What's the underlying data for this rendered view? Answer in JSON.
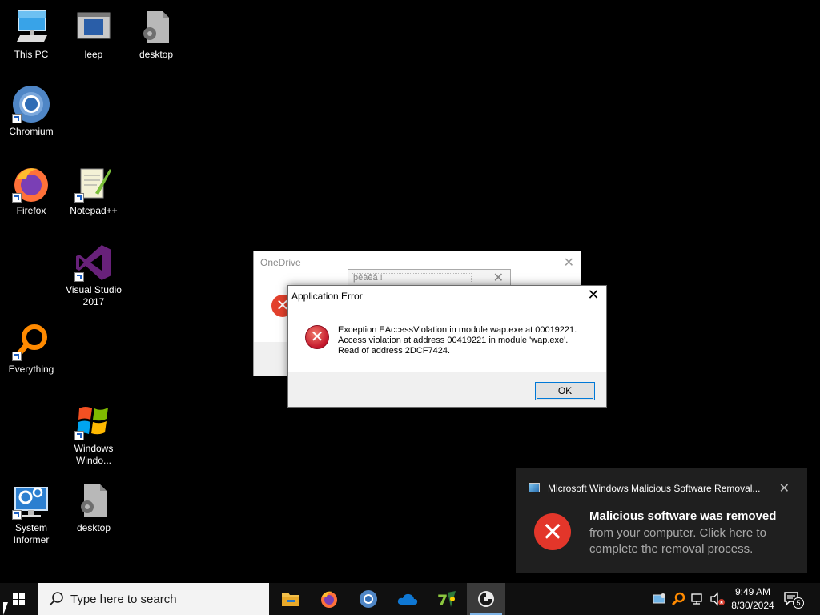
{
  "desktop": {
    "icons": [
      {
        "label": "This PC"
      },
      {
        "label": "leep"
      },
      {
        "label": "desktop"
      },
      {
        "label": "Chromium"
      },
      {
        "label": "Firefox"
      },
      {
        "label": "Notepad++"
      },
      {
        "label": "Visual Studio 2017"
      },
      {
        "label": "Everything"
      },
      {
        "label": "Windows Windo..."
      },
      {
        "label": "System Informer"
      },
      {
        "label": "desktop"
      }
    ]
  },
  "onedrive_dialog": {
    "title": "OneDrive",
    "close": "✕",
    "inner_box_text": "þéàêà !",
    "inner_close": "✕"
  },
  "app_error": {
    "title": "Application Error",
    "close": "✕",
    "message_lines": [
      "Exception EAccessViolation in module wap.exe at 00019221.",
      "Access violation at address 00419221 in module 'wap.exe'.",
      "Read of address 2DCF7424."
    ],
    "ok_label": "OK"
  },
  "toast": {
    "app_name": "Microsoft Windows Malicious Software Removal...",
    "close": "✕",
    "headline": "Malicious software was removed",
    "body": "from your computer. Click here to complete the removal process."
  },
  "taskbar": {
    "search_placeholder": "Type here to search",
    "apps": [
      "file-explorer-icon",
      "firefox-icon",
      "chromium-icon",
      "onedrive-icon",
      "7zip-icon",
      "wap-app-icon"
    ],
    "clock_time": "9:49 AM",
    "clock_date": "8/30/2024",
    "notification_count": "5"
  },
  "colors": {
    "desktop_bg": "#000000",
    "taskbar_bg": "#101010",
    "toast_bg": "#1f1f1f",
    "error_red": "#e3362a",
    "accent": "#0078d7"
  }
}
